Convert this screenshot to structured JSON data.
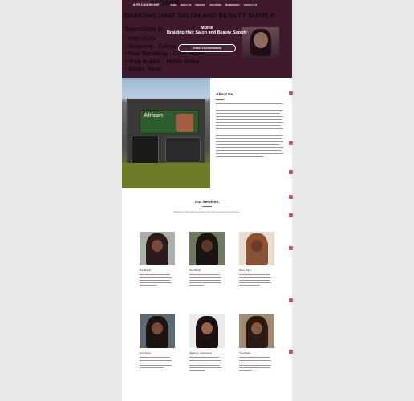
{
  "nav": {
    "brand": "AFRICAN MONIE",
    "items": [
      "HOME",
      "ABOUT US",
      "SERVICES",
      "OUR WORK",
      "MEMBERSHIP",
      "CONTACT US"
    ]
  },
  "hero": {
    "bg_title": "MONIE",
    "bg_subtitle": "BRAIDING HAIR SALON AND BEAUTY SUPPLY",
    "bg_specialize": "Specialize in",
    "bg_list": [
      "Hair Cuts",
      "Weaving - Extensions",
      "Hair Breading - Corn Rows",
      "Tree Braids - Micro Braid",
      "Kinky Twist"
    ],
    "title": "Monie",
    "subtitle": "Braiding Hair Salon and Beauty Supply",
    "appointment_button": "SCHEDULE AN APPOINTMENT"
  },
  "about": {
    "title": "About Us.",
    "sign_text": "African"
  },
  "services": {
    "title": "Our Services.",
    "subtitle": "Read some of the services we provide if you have any questions just to any time.",
    "items": [
      {
        "name": "Box Braids"
      },
      {
        "name": "Twist Braid"
      },
      {
        "name": "Micro Braid"
      },
      {
        "name": "Corn Rows"
      },
      {
        "name": "Weaving - Extensions"
      },
      {
        "name": "Tree Braids"
      }
    ]
  },
  "colors": {
    "hero_bg": "#3e1a2c",
    "accent": "#c95076"
  }
}
